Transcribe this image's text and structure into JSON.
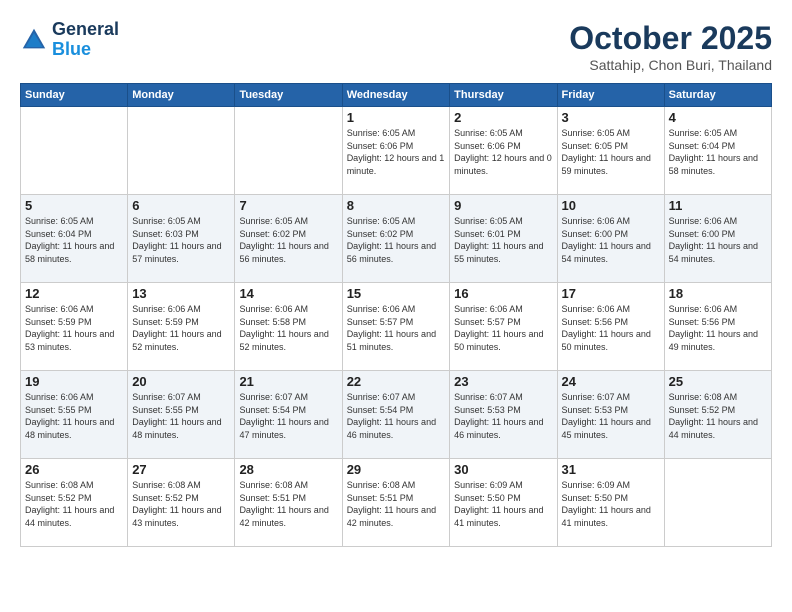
{
  "header": {
    "logo_line1": "General",
    "logo_line2": "Blue",
    "month": "October 2025",
    "location": "Sattahip, Chon Buri, Thailand"
  },
  "weekdays": [
    "Sunday",
    "Monday",
    "Tuesday",
    "Wednesday",
    "Thursday",
    "Friday",
    "Saturday"
  ],
  "weeks": [
    [
      {
        "day": "",
        "sunrise": "",
        "sunset": "",
        "daylight": ""
      },
      {
        "day": "",
        "sunrise": "",
        "sunset": "",
        "daylight": ""
      },
      {
        "day": "",
        "sunrise": "",
        "sunset": "",
        "daylight": ""
      },
      {
        "day": "1",
        "sunrise": "Sunrise: 6:05 AM",
        "sunset": "Sunset: 6:06 PM",
        "daylight": "Daylight: 12 hours and 1 minute."
      },
      {
        "day": "2",
        "sunrise": "Sunrise: 6:05 AM",
        "sunset": "Sunset: 6:06 PM",
        "daylight": "Daylight: 12 hours and 0 minutes."
      },
      {
        "day": "3",
        "sunrise": "Sunrise: 6:05 AM",
        "sunset": "Sunset: 6:05 PM",
        "daylight": "Daylight: 11 hours and 59 minutes."
      },
      {
        "day": "4",
        "sunrise": "Sunrise: 6:05 AM",
        "sunset": "Sunset: 6:04 PM",
        "daylight": "Daylight: 11 hours and 58 minutes."
      }
    ],
    [
      {
        "day": "5",
        "sunrise": "Sunrise: 6:05 AM",
        "sunset": "Sunset: 6:04 PM",
        "daylight": "Daylight: 11 hours and 58 minutes."
      },
      {
        "day": "6",
        "sunrise": "Sunrise: 6:05 AM",
        "sunset": "Sunset: 6:03 PM",
        "daylight": "Daylight: 11 hours and 57 minutes."
      },
      {
        "day": "7",
        "sunrise": "Sunrise: 6:05 AM",
        "sunset": "Sunset: 6:02 PM",
        "daylight": "Daylight: 11 hours and 56 minutes."
      },
      {
        "day": "8",
        "sunrise": "Sunrise: 6:05 AM",
        "sunset": "Sunset: 6:02 PM",
        "daylight": "Daylight: 11 hours and 56 minutes."
      },
      {
        "day": "9",
        "sunrise": "Sunrise: 6:05 AM",
        "sunset": "Sunset: 6:01 PM",
        "daylight": "Daylight: 11 hours and 55 minutes."
      },
      {
        "day": "10",
        "sunrise": "Sunrise: 6:06 AM",
        "sunset": "Sunset: 6:00 PM",
        "daylight": "Daylight: 11 hours and 54 minutes."
      },
      {
        "day": "11",
        "sunrise": "Sunrise: 6:06 AM",
        "sunset": "Sunset: 6:00 PM",
        "daylight": "Daylight: 11 hours and 54 minutes."
      }
    ],
    [
      {
        "day": "12",
        "sunrise": "Sunrise: 6:06 AM",
        "sunset": "Sunset: 5:59 PM",
        "daylight": "Daylight: 11 hours and 53 minutes."
      },
      {
        "day": "13",
        "sunrise": "Sunrise: 6:06 AM",
        "sunset": "Sunset: 5:59 PM",
        "daylight": "Daylight: 11 hours and 52 minutes."
      },
      {
        "day": "14",
        "sunrise": "Sunrise: 6:06 AM",
        "sunset": "Sunset: 5:58 PM",
        "daylight": "Daylight: 11 hours and 52 minutes."
      },
      {
        "day": "15",
        "sunrise": "Sunrise: 6:06 AM",
        "sunset": "Sunset: 5:57 PM",
        "daylight": "Daylight: 11 hours and 51 minutes."
      },
      {
        "day": "16",
        "sunrise": "Sunrise: 6:06 AM",
        "sunset": "Sunset: 5:57 PM",
        "daylight": "Daylight: 11 hours and 50 minutes."
      },
      {
        "day": "17",
        "sunrise": "Sunrise: 6:06 AM",
        "sunset": "Sunset: 5:56 PM",
        "daylight": "Daylight: 11 hours and 50 minutes."
      },
      {
        "day": "18",
        "sunrise": "Sunrise: 6:06 AM",
        "sunset": "Sunset: 5:56 PM",
        "daylight": "Daylight: 11 hours and 49 minutes."
      }
    ],
    [
      {
        "day": "19",
        "sunrise": "Sunrise: 6:06 AM",
        "sunset": "Sunset: 5:55 PM",
        "daylight": "Daylight: 11 hours and 48 minutes."
      },
      {
        "day": "20",
        "sunrise": "Sunrise: 6:07 AM",
        "sunset": "Sunset: 5:55 PM",
        "daylight": "Daylight: 11 hours and 48 minutes."
      },
      {
        "day": "21",
        "sunrise": "Sunrise: 6:07 AM",
        "sunset": "Sunset: 5:54 PM",
        "daylight": "Daylight: 11 hours and 47 minutes."
      },
      {
        "day": "22",
        "sunrise": "Sunrise: 6:07 AM",
        "sunset": "Sunset: 5:54 PM",
        "daylight": "Daylight: 11 hours and 46 minutes."
      },
      {
        "day": "23",
        "sunrise": "Sunrise: 6:07 AM",
        "sunset": "Sunset: 5:53 PM",
        "daylight": "Daylight: 11 hours and 46 minutes."
      },
      {
        "day": "24",
        "sunrise": "Sunrise: 6:07 AM",
        "sunset": "Sunset: 5:53 PM",
        "daylight": "Daylight: 11 hours and 45 minutes."
      },
      {
        "day": "25",
        "sunrise": "Sunrise: 6:08 AM",
        "sunset": "Sunset: 5:52 PM",
        "daylight": "Daylight: 11 hours and 44 minutes."
      }
    ],
    [
      {
        "day": "26",
        "sunrise": "Sunrise: 6:08 AM",
        "sunset": "Sunset: 5:52 PM",
        "daylight": "Daylight: 11 hours and 44 minutes."
      },
      {
        "day": "27",
        "sunrise": "Sunrise: 6:08 AM",
        "sunset": "Sunset: 5:52 PM",
        "daylight": "Daylight: 11 hours and 43 minutes."
      },
      {
        "day": "28",
        "sunrise": "Sunrise: 6:08 AM",
        "sunset": "Sunset: 5:51 PM",
        "daylight": "Daylight: 11 hours and 42 minutes."
      },
      {
        "day": "29",
        "sunrise": "Sunrise: 6:08 AM",
        "sunset": "Sunset: 5:51 PM",
        "daylight": "Daylight: 11 hours and 42 minutes."
      },
      {
        "day": "30",
        "sunrise": "Sunrise: 6:09 AM",
        "sunset": "Sunset: 5:50 PM",
        "daylight": "Daylight: 11 hours and 41 minutes."
      },
      {
        "day": "31",
        "sunrise": "Sunrise: 6:09 AM",
        "sunset": "Sunset: 5:50 PM",
        "daylight": "Daylight: 11 hours and 41 minutes."
      },
      {
        "day": "",
        "sunrise": "",
        "sunset": "",
        "daylight": ""
      }
    ]
  ]
}
